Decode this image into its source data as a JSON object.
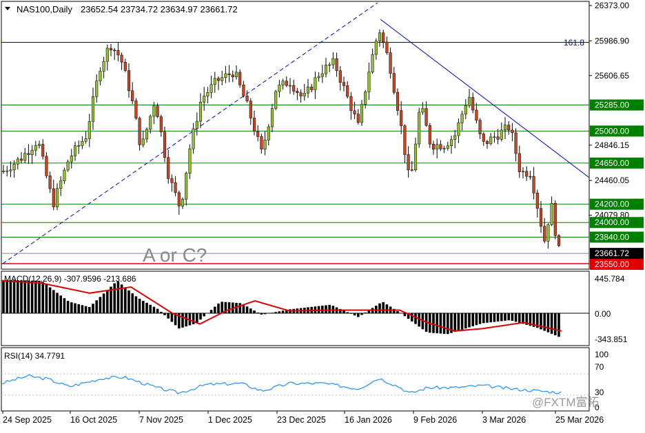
{
  "header": {
    "symbol": "NAS100,Daily",
    "ohlc": "23652.54 23734.72 23634.97 23661.72"
  },
  "annotation": "A or C?",
  "fib_label": "161.8",
  "watermark": "@FXTM富拓",
  "price_axis": {
    "ticks": [
      {
        "label": "26373.00",
        "value": 26373
      },
      {
        "label": "25986.90",
        "value": 25987
      },
      {
        "label": "25606.65",
        "value": 25607
      },
      {
        "label": "24846.15",
        "value": 24846
      },
      {
        "label": "24460.05",
        "value": 24460
      },
      {
        "label": "24079.80",
        "value": 24080
      }
    ],
    "levels": [
      {
        "label": "25285.00",
        "value": 25285
      },
      {
        "label": "25000.00",
        "value": 25000
      },
      {
        "label": "24650.00",
        "value": 24650
      },
      {
        "label": "24200.00",
        "value": 24200
      },
      {
        "label": "24000.00",
        "value": 24000
      },
      {
        "label": "23840.00",
        "value": 23840
      }
    ],
    "current": {
      "label": "23661.72",
      "value": 23662
    },
    "red_level": {
      "label": "23550.00",
      "value": 23550
    },
    "fib_value": 25970
  },
  "macd_panel": {
    "label": "MACD(12,26,9) -307.9596 -213.686",
    "ticks": [
      "445.784",
      "0.00",
      "-343.851"
    ]
  },
  "rsi_panel": {
    "label": "RSI(14) 34.7791",
    "ticks": [
      "100",
      "70",
      "30",
      "0"
    ]
  },
  "time_axis": [
    "24 Sep 2025",
    "16 Oct 2025",
    "7 Nov 2025",
    "1 Dec 2025",
    "23 Dec 2025",
    "16 Jan 2026",
    "9 Feb 2026",
    "3 Mar 2026",
    "25 Mar 2026"
  ],
  "colors": {
    "up": "#90c030",
    "down": "#cc4422",
    "level": "#008000",
    "trend": "#0000cc",
    "macd_signal": "#dd0000",
    "rsi": "#1e90ff"
  },
  "chart_data": [
    {
      "type": "candlestick",
      "title": "NAS100,Daily",
      "ylim": [
        23500,
        26373
      ],
      "key_points": [
        {
          "label": "24 Sep 2025",
          "close": 24500
        },
        {
          "label": "16 Oct 2025",
          "close": 25800
        },
        {
          "label": "7 Nov 2025",
          "close": 24850
        },
        {
          "label": "1 Dec 2025",
          "close": 25500
        },
        {
          "label": "23 Dec 2025",
          "close": 25550
        },
        {
          "label": "16 Jan 2026",
          "close": 25750
        },
        {
          "label": "9 Feb 2026",
          "close": 24800
        },
        {
          "label": "3 Mar 2026",
          "close": 24800
        },
        {
          "label": "25 Mar 2026",
          "close": 23662
        }
      ],
      "horizontal_levels": [
        25285,
        25000,
        24650,
        24200,
        24000,
        23840,
        23550
      ],
      "last_price": 23661.72
    },
    {
      "type": "bar",
      "title": "MACD(12,26,9)",
      "values_last": {
        "macd": -307.9596,
        "signal": -213.686
      },
      "ylim": [
        -343.851,
        445.784
      ]
    },
    {
      "type": "line",
      "title": "RSI(14)",
      "last": 34.7791,
      "levels": [
        30,
        70
      ],
      "ylim": [
        0,
        100
      ]
    }
  ]
}
